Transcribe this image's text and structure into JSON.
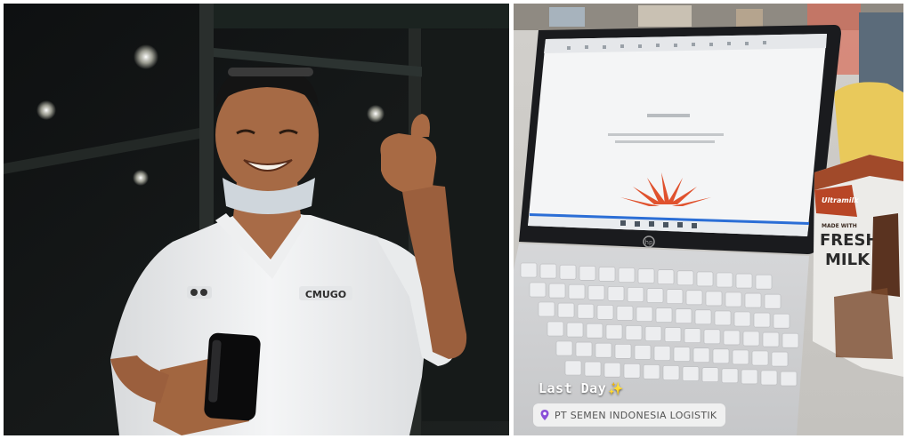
{
  "left_photo": {
    "shirt_logo_text": "CMUGO"
  },
  "right_photo": {
    "carton_text_line1": "FRESH",
    "carton_text_line2": "MILK",
    "carton_small_text": "MADE WITH",
    "laptop_brand": "hp",
    "story_caption": "Last Day",
    "story_emoji": "✨",
    "location_label": "PT SEMEN INDONESIA LOGISTIK",
    "location_icon": "map-pin-icon"
  },
  "colors": {
    "accent_logo": "#e0522e",
    "screen_bg": "#f4f5f6",
    "taskbar": "#2b6ed6"
  }
}
